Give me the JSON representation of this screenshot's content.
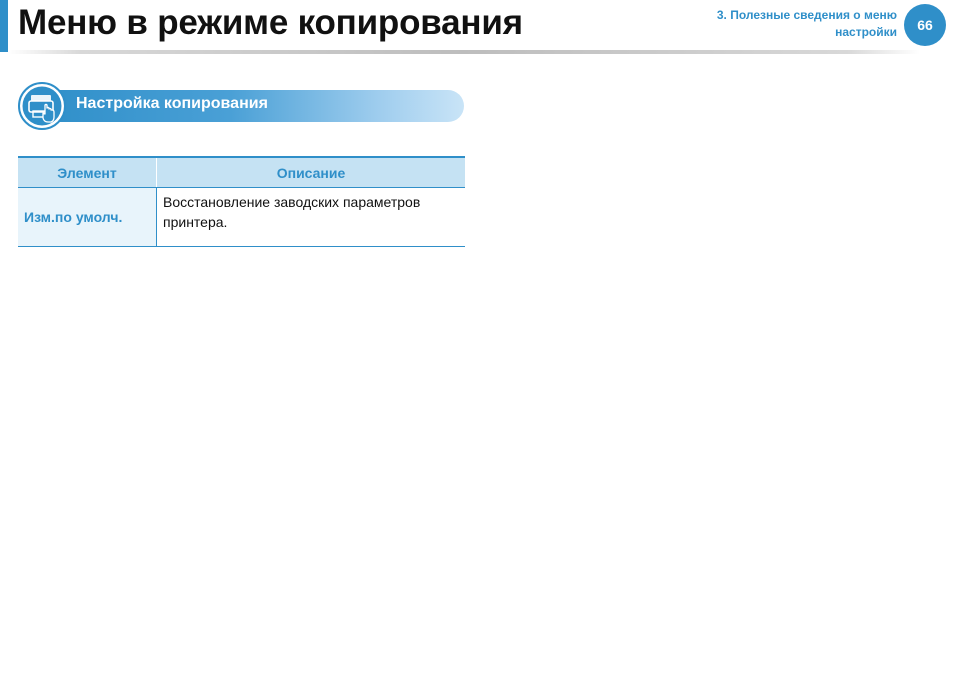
{
  "header": {
    "title": "Меню в режиме копирования",
    "chapter_line1": "3.  Полезные сведения о меню",
    "chapter_line2": "настройки",
    "page_number": "66",
    "accent_color": "#2f8fc9"
  },
  "section": {
    "title": "Настройка копирования",
    "icon": "printer-hand-icon"
  },
  "table": {
    "headers": [
      "Элемент",
      "Описание"
    ],
    "rows": [
      {
        "element": "Изм.по умолч.",
        "description": "Восстановление заводских параметров принтера."
      }
    ]
  }
}
